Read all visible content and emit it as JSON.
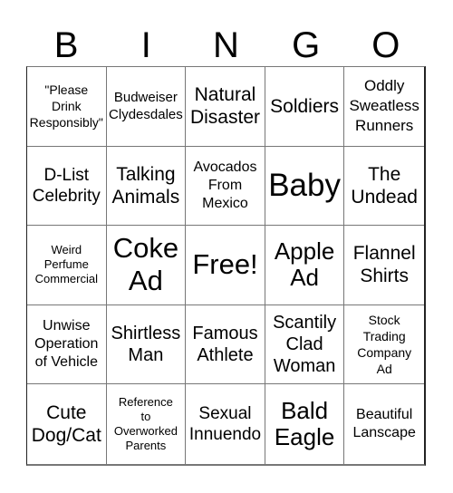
{
  "title_letters": [
    "B",
    "I",
    "N",
    "G",
    "O"
  ],
  "cells": [
    "\"Please\nDrink\nResponsibly\"",
    "Budweiser\nClydesdales",
    "Natural\nDisaster",
    "Soldiers",
    "Oddly\nSweatless\nRunners",
    "D-List\nCelebrity",
    "Talking\nAnimals",
    "Avocados\nFrom\nMexico",
    "Baby",
    "The\nUndead",
    "Weird\nPerfume\nCommercial",
    "Coke\nAd",
    "Free!",
    "Apple\nAd",
    "Flannel\nShirts",
    "Unwise\nOperation\nof Vehicle",
    "Shirtless\nMan",
    "Famous\nAthlete",
    "Scantily\nClad\nWoman",
    "Stock\nTrading\nCompany\nAd",
    "Cute\nDog/Cat",
    "Reference\nto\nOverworked\nParents",
    "Sexual\nInnuendo",
    "Bald\nEagle",
    "Beautiful\nLanscape"
  ]
}
